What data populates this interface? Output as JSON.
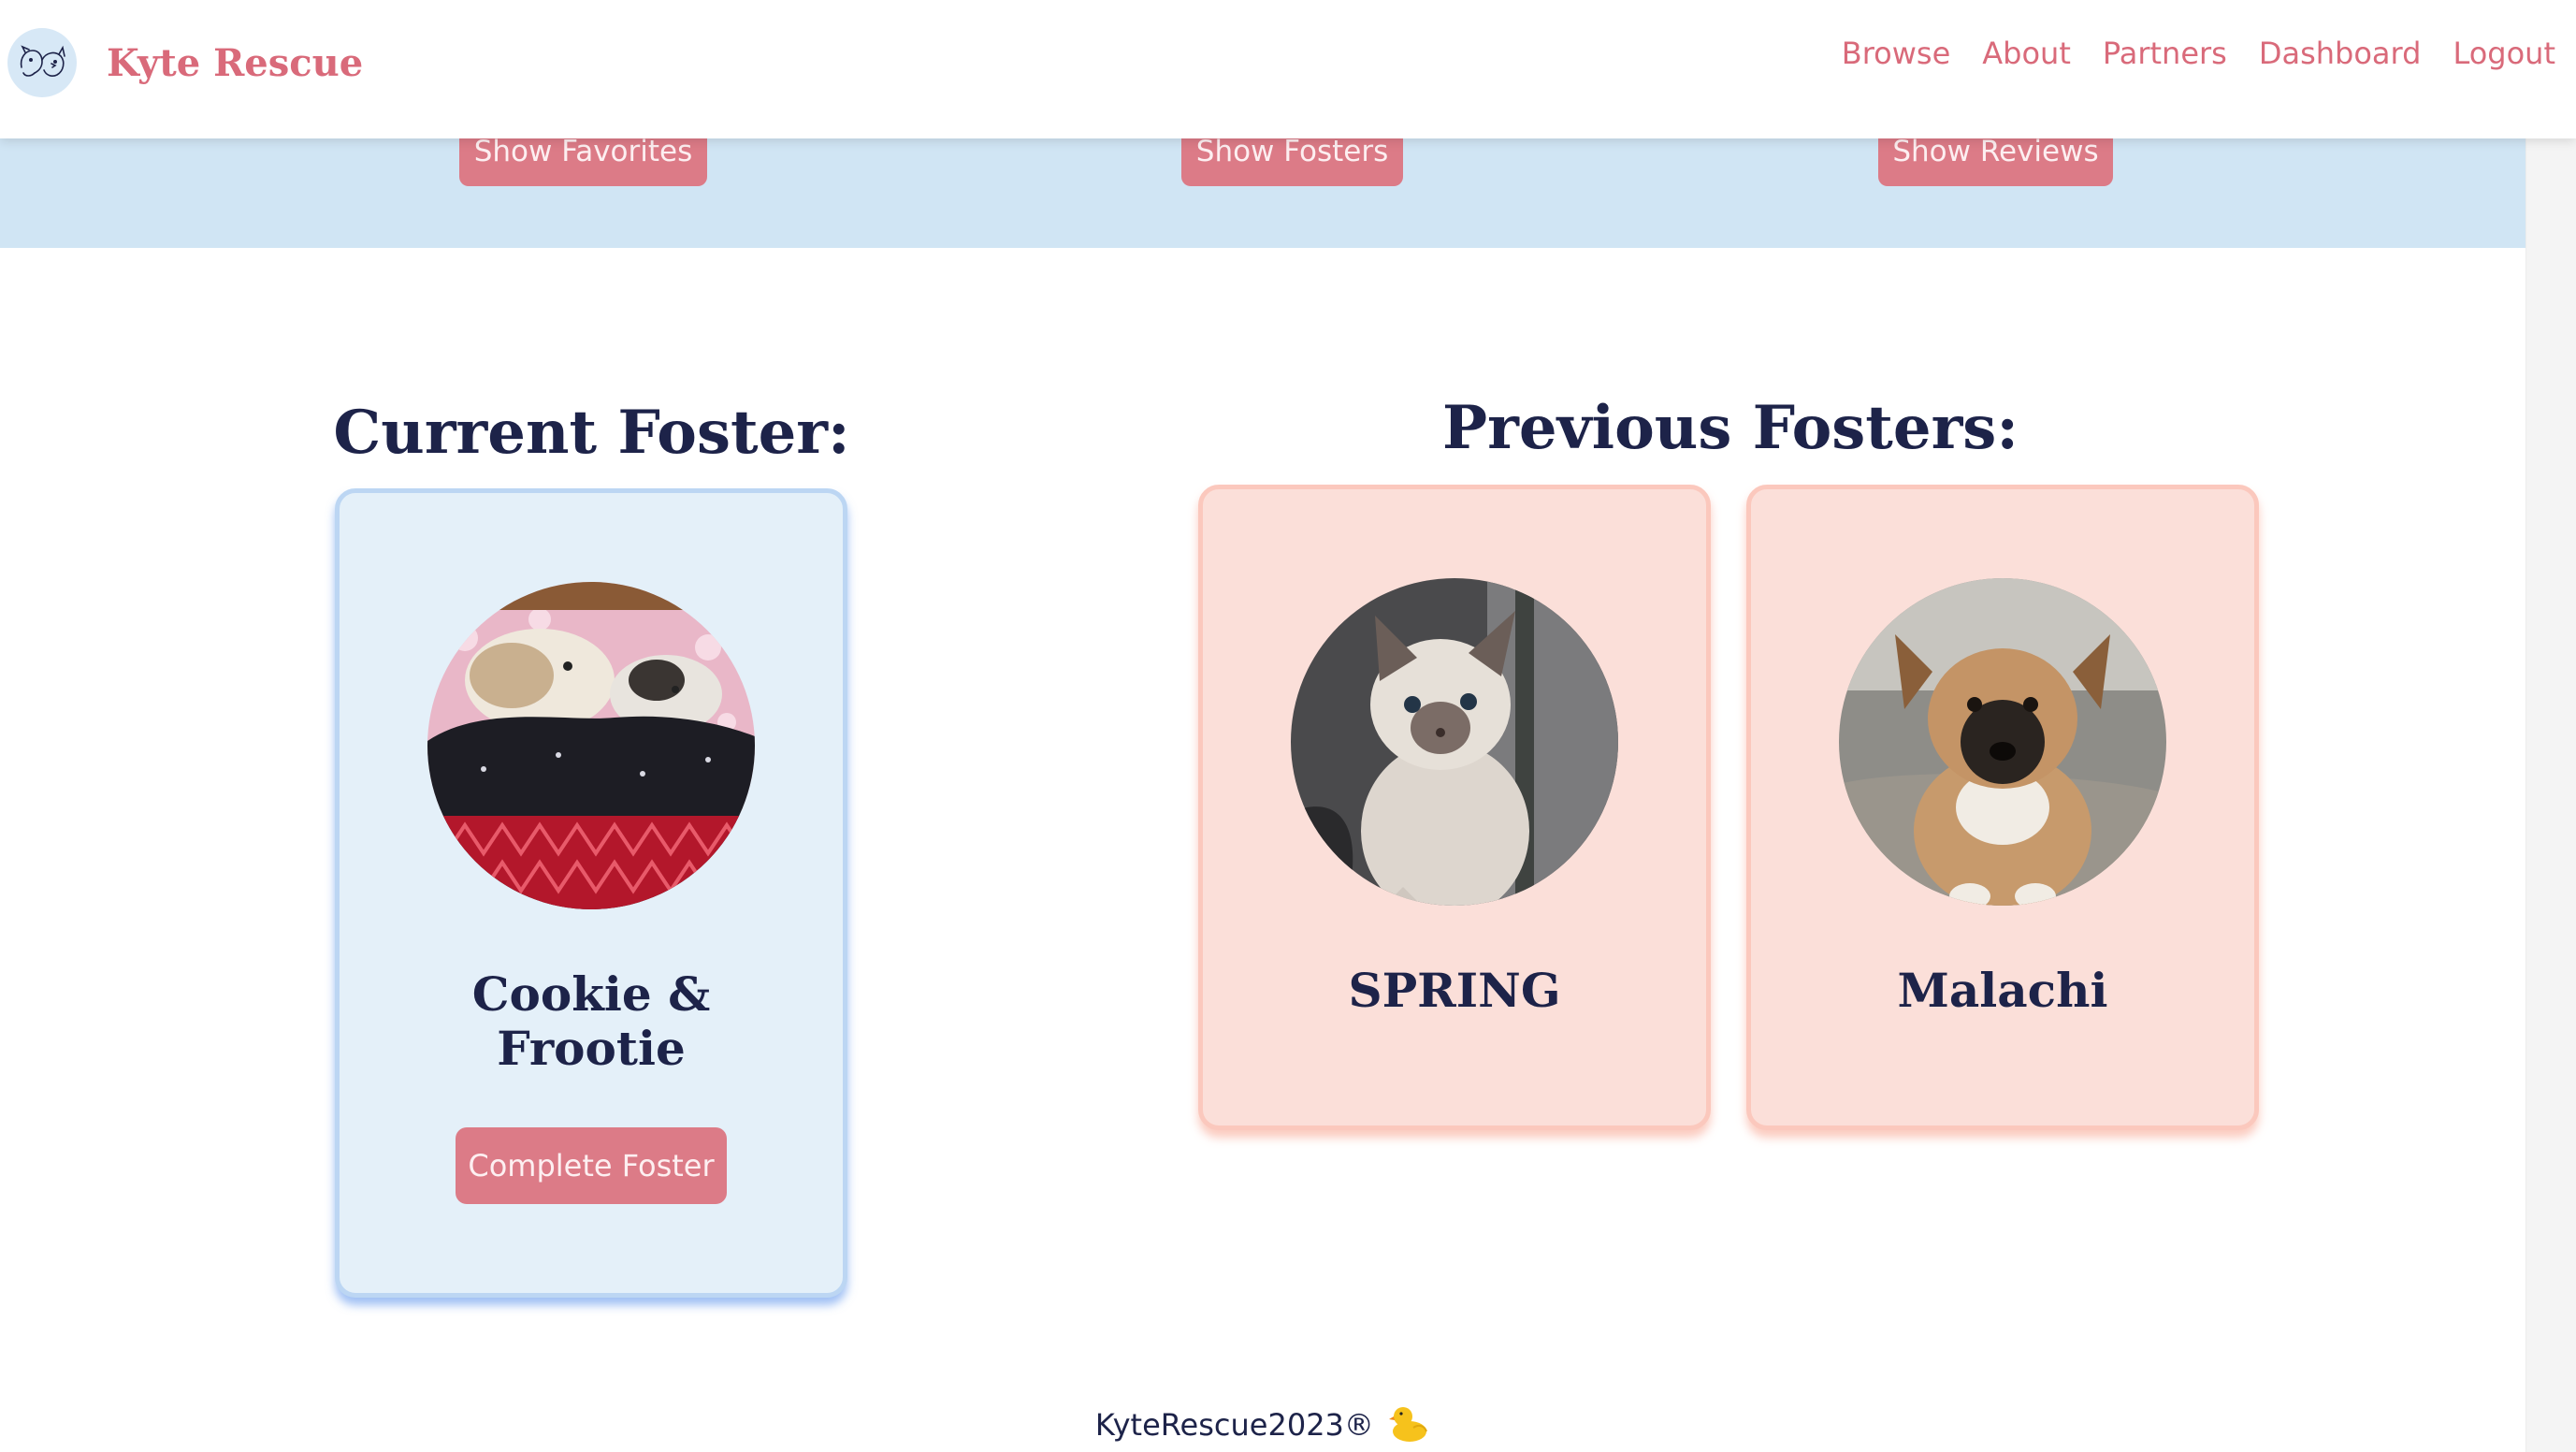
{
  "navbar": {
    "brand": "Kyte Rescue",
    "logo_icon": "dog-cat-logo-icon",
    "links": [
      "Browse",
      "About",
      "Partners",
      "Dashboard",
      "Logout"
    ]
  },
  "band": {
    "show_favorites": "Show Favorites",
    "show_fosters": "Show Fosters",
    "show_reviews": "Show Reviews"
  },
  "current": {
    "heading": "Current Foster:",
    "pet_name": "Cookie & Frootie",
    "button": "Complete Foster"
  },
  "previous": {
    "heading": "Previous Fosters:",
    "pets": [
      "SPRING",
      "Malachi"
    ]
  },
  "footer": {
    "text": "KyteRescue2023®",
    "icon": "duck-icon"
  },
  "colors": {
    "accent": "#dc7b87",
    "brand_text": "#d96a7a",
    "heading": "#1d2349",
    "band": "#d0e5f4",
    "current_card": "#e4f0f9",
    "previous_card": "#fbdfd9"
  }
}
